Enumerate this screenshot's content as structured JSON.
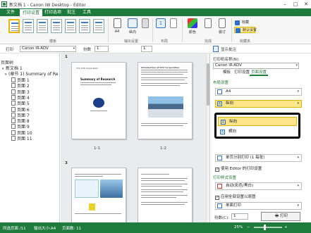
{
  "window": {
    "title": "新文档 1 - Canon iW Desktop - Editor"
  },
  "menu": {
    "items": [
      "文件",
      "打印设置",
      "打印选项",
      "批注",
      "工具"
    ],
    "active_index": 1
  },
  "ribbon": {
    "group_templates": "模板",
    "group_output": "输出设置",
    "group_layout": "布局",
    "group_finishing": "完成",
    "group_favorites": "收藏夹",
    "paper_size": "A4",
    "orientation": "纵向",
    "layout_value": "1",
    "btn_color": "颜色",
    "btn_finish": "装订",
    "favorites": [
      {
        "label": "收藏"
      },
      {
        "label": "默认设置"
      }
    ]
  },
  "toolbar": {
    "printer_label": "打印",
    "printer_value": "Canon iR-ADV",
    "copies_label": "份数",
    "copies_value": "1",
    "page_value": "1",
    "view_label": "显示批注"
  },
  "left_panel": {
    "header": "页面树",
    "doc": "新文档 1",
    "section": "(章节 1) Summary of Re",
    "pages": [
      "页面 1",
      "页面 2",
      "页面 3",
      "页面 4",
      "页面 5",
      "页面 6",
      "页面 7",
      "页面 8",
      "页面 9",
      "页面 10",
      "页面 11"
    ]
  },
  "center": {
    "pages": [
      {
        "num": "1",
        "label": "1-1"
      },
      {
        "num": "",
        "label": "1-2"
      },
      {
        "num": "3",
        "label": ""
      },
      {
        "num": "",
        "label": ""
      }
    ],
    "page1_header": "The XYZ Corporation",
    "page1_title": "Summary of Research",
    "page2_title": "Introduction of XYZ Corporation"
  },
  "right_panel": {
    "printer_label": "打印机名称(N):",
    "printer_value": "Canon iR-ADV",
    "tabs": [
      "模板",
      "打印设置",
      "页面设置"
    ],
    "active_tab": 2,
    "section_paper": "布局设置",
    "paper_size": "A4",
    "orientation_current": "纵向",
    "orientation_options": [
      "纵向",
      "横向"
    ],
    "orientation_selected": 0,
    "layout_value": "单页分别打印 (1 每张)",
    "layout_placeholder": "使用 Editor 的打印设置",
    "use_editor_checked": true,
    "use_editor_label": "使用 Editor 的打印设置",
    "section_finishing": "打印样式设置",
    "finish_value": "自动(彩色/黑白)",
    "check2_label": "应用全部设置以原图",
    "check2_checked": true,
    "staple_value": "单面打印",
    "copies_label": "份数(C):",
    "copies_value": "1",
    "print_button": "打印"
  },
  "status": {
    "page_info": "所选页面 /11",
    "size_info": "输出大小:A4",
    "pages_info": "页面数: 11",
    "zoom": "25%"
  }
}
